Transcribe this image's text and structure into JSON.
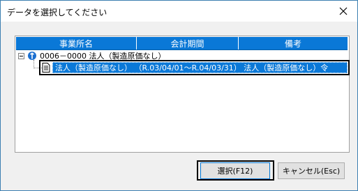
{
  "window": {
    "title": "データを選択してください"
  },
  "table": {
    "headers": [
      "事業所名",
      "会計期間",
      "備考"
    ]
  },
  "tree": {
    "root": {
      "label": "0006－0000 法人（製造原価なし）"
    },
    "child": {
      "label": "法人（製造原価なし） （R.03/04/01～R.04/03/31） 法人（製造原価なし）令"
    }
  },
  "buttons": {
    "select": "選択(F12)",
    "cancel": "キャンセル(Esc)"
  },
  "colors": {
    "accent": "#0a78d7",
    "background": "#f0f0f0"
  }
}
